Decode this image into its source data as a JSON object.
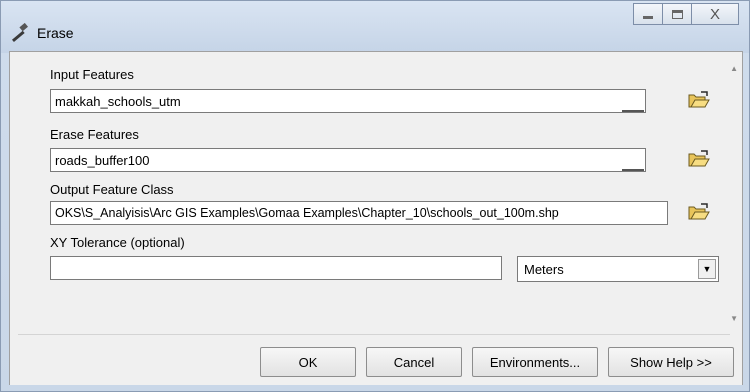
{
  "window": {
    "title": "Erase",
    "close_glyph": "X"
  },
  "form": {
    "input_features": {
      "label": "Input Features",
      "value": "makkah_schools_utm"
    },
    "erase_features": {
      "label": "Erase Features",
      "value": "roads_buffer100"
    },
    "output_feature_class": {
      "label": "Output Feature Class",
      "value": "OKS\\S_Analyisis\\Arc GIS Examples\\Gomaa Examples\\Chapter_10\\schools_out_100m.shp"
    },
    "xy_tolerance": {
      "label": "XY Tolerance (optional)",
      "value": "",
      "unit": "Meters"
    }
  },
  "buttons": {
    "ok": "OK",
    "cancel": "Cancel",
    "environments": "Environments...",
    "show_help": "Show Help >>"
  },
  "icons": {
    "title_icon": "hammer-icon",
    "folder_icon": "open-folder-icon"
  }
}
